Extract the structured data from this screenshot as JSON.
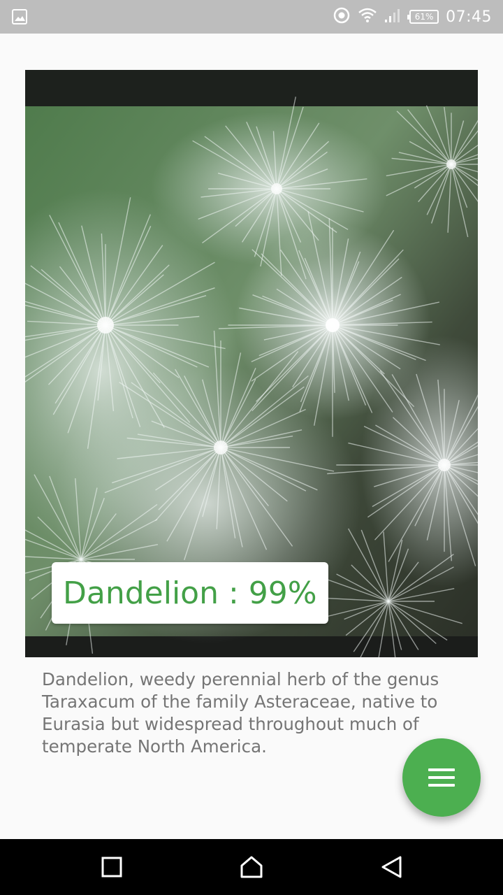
{
  "status_bar": {
    "time": "07:45",
    "battery": "61%",
    "icons": [
      "image-icon",
      "data-saver-icon",
      "wifi-icon",
      "signal-icon",
      "battery-icon"
    ]
  },
  "photo": {
    "subject": "dandelion seed head close-up"
  },
  "result": {
    "label": "Dandelion : 99%",
    "confidence": 99,
    "color": "#43a047"
  },
  "description": "Dandelion, weedy perennial herb of the genus Taraxacum of the family Asteraceae, native to Eurasia but widespread throughout much of temperate North America.",
  "fab": {
    "icon": "menu-icon",
    "color": "#4caf50"
  },
  "nav_bar": {
    "buttons": [
      "recents-icon",
      "home-icon",
      "back-icon"
    ]
  }
}
